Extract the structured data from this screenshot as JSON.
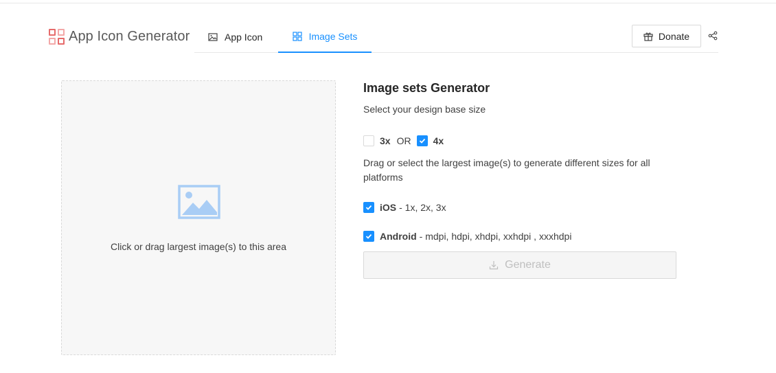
{
  "brand": {
    "title": "App Icon Generator",
    "logo_icon": "grid-logo-icon"
  },
  "tabs": [
    {
      "label": "App Icon",
      "icon": "picture-icon",
      "active": false
    },
    {
      "label": "Image Sets",
      "icon": "appstore-icon",
      "active": true
    }
  ],
  "header": {
    "donate_label": "Donate",
    "donate_icon": "gift-icon",
    "share_icon": "share-icon"
  },
  "dropzone": {
    "text": "Click or drag largest image(s) to this area",
    "icon": "image-placeholder-icon"
  },
  "panel": {
    "title": "Image sets Generator",
    "subtitle": "Select your design base size",
    "base_sizes": [
      {
        "label": "3x",
        "checked": false
      },
      {
        "label": "4x",
        "checked": true
      }
    ],
    "or_label": "OR",
    "description": "Drag or select the largest image(s) to generate different sizes for all platforms",
    "platforms": [
      {
        "name": "iOS",
        "sizes": "- 1x, 2x, 3x",
        "checked": true
      },
      {
        "name": "Android",
        "sizes": "- mdpi, hdpi, xhdpi, xxhdpi , xxxhdpi",
        "checked": true
      }
    ],
    "generate_label": "Generate",
    "generate_icon": "download-icon",
    "generate_disabled": true
  },
  "colors": {
    "accent": "#1890ff",
    "logo": "#e66b6b",
    "disabled_text": "#bfbfbf"
  }
}
